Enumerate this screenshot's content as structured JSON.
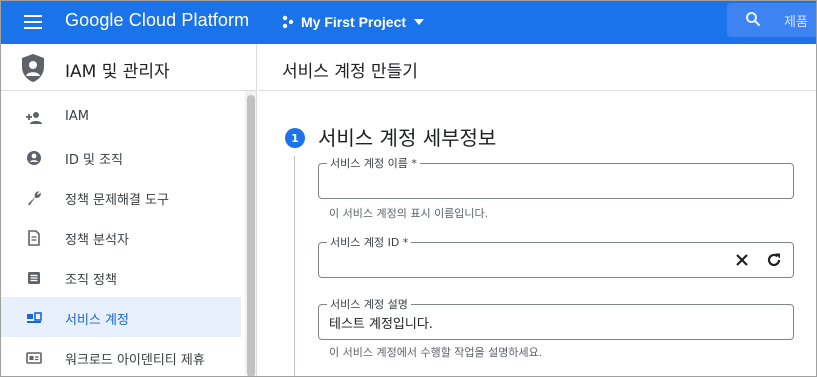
{
  "topbar": {
    "brand": "Google Cloud Platform",
    "project_name": "My First Project",
    "search_placeholder": "제품"
  },
  "sidebar": {
    "title": "IAM 및 관리자",
    "items": [
      {
        "label": "IAM",
        "icon": "person-add-icon"
      },
      {
        "label": "ID 및 조직",
        "icon": "account-circle-icon"
      },
      {
        "label": "정책 문제해결 도구",
        "icon": "wrench-icon"
      },
      {
        "label": "정책 분석자",
        "icon": "policy-document-icon"
      },
      {
        "label": "조직 정책",
        "icon": "list-alt-icon"
      },
      {
        "label": "서비스 계정",
        "icon": "service-account-icon",
        "active": true
      },
      {
        "label": "워크로드 아이덴티티 제휴",
        "icon": "id-card-icon"
      }
    ]
  },
  "main": {
    "page_title": "서비스 계정 만들기",
    "step": {
      "number": "1",
      "title": "서비스 계정 세부정보"
    },
    "fields": {
      "name": {
        "label": "서비스 계정 이름 *",
        "value": "",
        "hint": "이 서비스 계정의 표시 이름입니다."
      },
      "id": {
        "label": "서비스 계정 ID *",
        "value": ""
      },
      "description": {
        "label": "서비스 계정 설명",
        "value": "테스트 계정입니다.",
        "hint": "이 서비스 계정에서 수행할 작업을 설명하세요."
      }
    }
  },
  "colors": {
    "accent": "#1a73e8",
    "active_bg": "#e8f0fe",
    "active_text": "#1967d2"
  }
}
